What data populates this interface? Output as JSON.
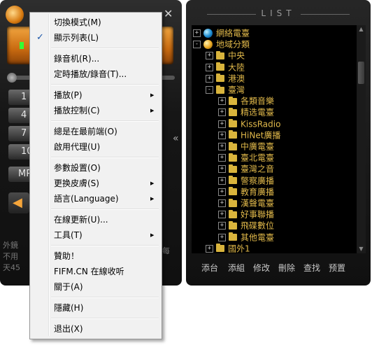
{
  "player": {
    "side_buttons": [
      "1",
      "4",
      "7",
      "10"
    ],
    "mode_button": "MP",
    "status_lines": [
      "外鏡",
      "不用",
      "天45"
    ],
    "status_right": "每"
  },
  "list": {
    "title": "LIST",
    "tree": [
      {
        "depth": 0,
        "expander": "+",
        "icon": "globe-icon",
        "label": "網絡電臺"
      },
      {
        "depth": 0,
        "expander": "-",
        "icon": "globe-icon",
        "label": "地域分類"
      },
      {
        "depth": 1,
        "expander": "+",
        "icon": "folder-icon",
        "label": "中央"
      },
      {
        "depth": 1,
        "expander": "+",
        "icon": "folder-icon",
        "label": "大陸"
      },
      {
        "depth": 1,
        "expander": "+",
        "icon": "folder-icon",
        "label": "港澳"
      },
      {
        "depth": 1,
        "expander": "-",
        "icon": "folder-icon",
        "label": "臺灣"
      },
      {
        "depth": 2,
        "expander": "+",
        "icon": "folder-icon",
        "label": "各類音樂"
      },
      {
        "depth": 2,
        "expander": "+",
        "icon": "folder-icon",
        "label": "精选電臺"
      },
      {
        "depth": 2,
        "expander": "+",
        "icon": "folder-icon",
        "label": "KissRadio"
      },
      {
        "depth": 2,
        "expander": "+",
        "icon": "folder-icon",
        "label": "HiNet廣播"
      },
      {
        "depth": 2,
        "expander": "+",
        "icon": "folder-icon",
        "label": "中廣電臺"
      },
      {
        "depth": 2,
        "expander": "+",
        "icon": "folder-icon",
        "label": "臺北電臺"
      },
      {
        "depth": 2,
        "expander": "+",
        "icon": "folder-icon",
        "label": "臺灣之音"
      },
      {
        "depth": 2,
        "expander": "+",
        "icon": "folder-icon",
        "label": "警察廣播"
      },
      {
        "depth": 2,
        "expander": "+",
        "icon": "folder-icon",
        "label": "教育廣播"
      },
      {
        "depth": 2,
        "expander": "+",
        "icon": "folder-icon",
        "label": "漢聲電臺"
      },
      {
        "depth": 2,
        "expander": "+",
        "icon": "folder-icon",
        "label": "好事聯播"
      },
      {
        "depth": 2,
        "expander": "+",
        "icon": "folder-icon",
        "label": "飛碟數位"
      },
      {
        "depth": 2,
        "expander": "+",
        "icon": "folder-icon",
        "label": "其他電臺"
      },
      {
        "depth": 1,
        "expander": "+",
        "icon": "folder-icon",
        "label": "國外1"
      }
    ],
    "toolbar": [
      "添台",
      "添組",
      "修改",
      "刪除",
      "查找",
      "预置"
    ]
  },
  "menu": {
    "items": [
      {
        "label": "切換模式(M)"
      },
      {
        "label": "顯示列表(L)",
        "checked": true
      },
      {
        "separator": true
      },
      {
        "label": "錄音机(R)..."
      },
      {
        "label": "定時播放/錄音(T)..."
      },
      {
        "separator": true
      },
      {
        "label": "播放(P)",
        "submenu": true
      },
      {
        "label": "播放控制(C)",
        "submenu": true
      },
      {
        "separator": true
      },
      {
        "label": "總是在最前端(O)"
      },
      {
        "label": "啟用代理(U)"
      },
      {
        "separator": true
      },
      {
        "label": "参數設置(O)"
      },
      {
        "label": "更换皮膚(S)",
        "submenu": true
      },
      {
        "label": "語言(Language)",
        "submenu": true
      },
      {
        "separator": true
      },
      {
        "label": "在線更新(U)..."
      },
      {
        "label": "工具(T)",
        "submenu": true
      },
      {
        "separator": true
      },
      {
        "label": "贊助！"
      },
      {
        "label": "FIFM.CN 在線收听"
      },
      {
        "label": "關于(A)"
      },
      {
        "separator": true
      },
      {
        "label": "隱藏(H)"
      },
      {
        "separator": true
      },
      {
        "label": "退出(X)"
      }
    ]
  },
  "colors": {
    "accent_orange": "#f5a53a",
    "tree_yellow": "#e0b84a",
    "menu_bg": "#f1f1f1",
    "check_blue": "#1a55a8"
  }
}
